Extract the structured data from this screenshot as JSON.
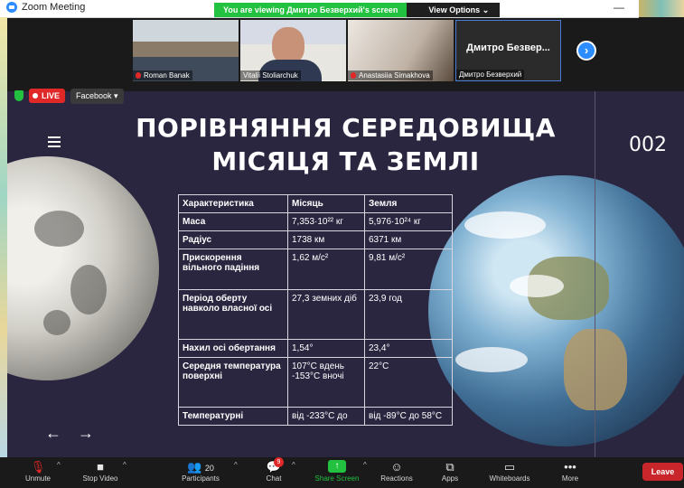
{
  "window": {
    "title": "Zoom Meeting",
    "minimize_icon": "minimize-icon"
  },
  "banner": {
    "message": "You are viewing Дмитро Безверхий's screen",
    "options_label": "View Options ⌄"
  },
  "thumbnails": [
    {
      "name": "Roman Banak",
      "muted": true
    },
    {
      "name": "Vitalii Stoliarchuk",
      "muted": false
    },
    {
      "name": "Anastasiia Simakhova",
      "muted": true
    },
    {
      "name": "Дмитро Безверхий",
      "display": "Дмитро  Безвер...",
      "muted": false
    }
  ],
  "livebar": {
    "live_label": "LIVE",
    "platform_label": "Facebook ▾"
  },
  "slide": {
    "title_line1": "ПОРІВНЯННЯ СЕРЕДОВИЩА",
    "title_line2": "МІСЯЦЯ ТА ЗЕМЛІ",
    "page_number": "002",
    "table": {
      "headers": [
        "Характеристика",
        "Місяць",
        "Земля"
      ],
      "rows": [
        [
          "Маса",
          "7,353·10²² кг",
          "5,976·10²⁴ кг"
        ],
        [
          "Радіус",
          "1738 км",
          "6371 км"
        ],
        [
          "Прискорення вільного падіння",
          "1,62 м/c²",
          "9,81 м/c²"
        ],
        [
          "Період оберту навколо власної осі",
          "27,3 земних діб",
          "23,9 год"
        ],
        [
          "Нахил осі обертання",
          "1,54°",
          "23,4°"
        ],
        [
          "Середня температура поверхні",
          "107°C вдень -153°C вночі",
          "22°C"
        ],
        [
          "Температурні",
          "від -233°C до",
          "від -89°C до 58°C"
        ]
      ]
    },
    "prev_arrow": "←",
    "next_arrow": "→"
  },
  "toolbar": {
    "unmute": "Unmute",
    "stop_video": "Stop Video",
    "participants": "Participants",
    "participants_count": "20",
    "chat": "Chat",
    "chat_badge": "9",
    "share_screen": "Share Screen",
    "reactions": "Reactions",
    "apps": "Apps",
    "whiteboards": "Whiteboards",
    "more": "More",
    "leave": "Leave"
  },
  "colors": {
    "zoom_blue": "#2D8CFF",
    "share_green": "#23c140",
    "leave_red": "#c8262a",
    "live_red": "#e02828"
  }
}
